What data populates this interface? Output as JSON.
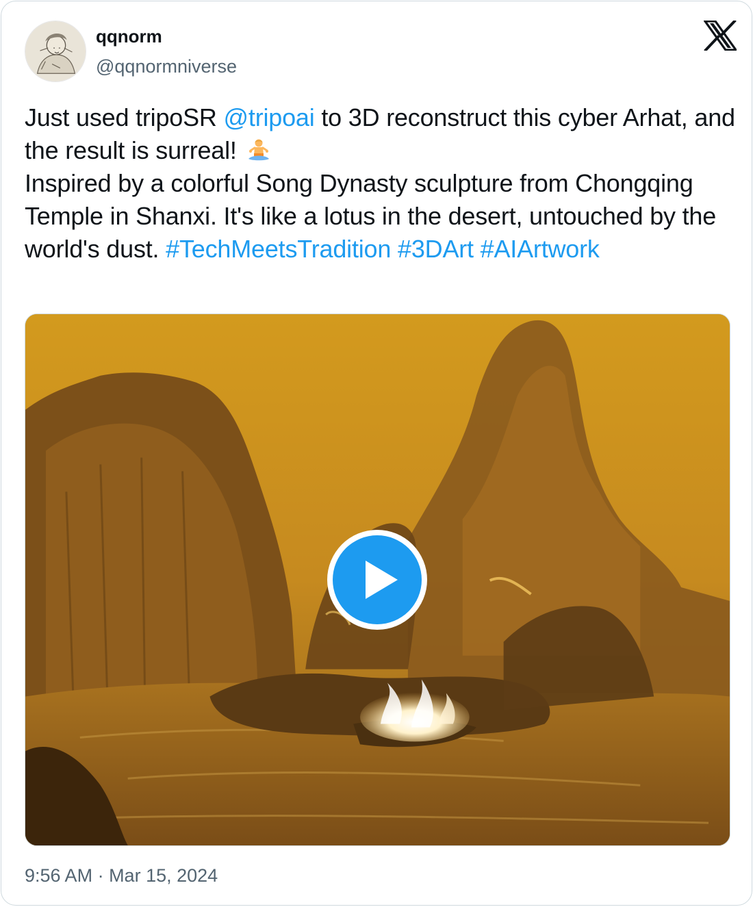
{
  "author": {
    "display_name": "qqnorm",
    "handle": "@qqnormniverse"
  },
  "tweet": {
    "text_1": "Just used tripoSR ",
    "mention": "@tripoai",
    "text_2": " to 3D reconstruct this cyber Arhat, and the result is surreal! ",
    "emoji": "person-in-lotus-position",
    "text_3": "Inspired by a colorful Song Dynasty sculpture from Chongqing Temple in Shanxi. It's like a lotus in the desert, untouched by the world's dust. ",
    "hashtag_1": "#TechMeetsTradition",
    "hashtag_2": "#3DArt",
    "hashtag_3": "#AIArtwork"
  },
  "media": {
    "type": "video",
    "play_icon": "play-icon"
  },
  "timestamp": {
    "time": "9:56 AM",
    "separator": " · ",
    "date": "Mar 15, 2024"
  },
  "icons": {
    "platform_logo": "x-logo-icon"
  },
  "colors": {
    "link": "#1d9bf0",
    "text": "#0f1419",
    "secondary": "#536471",
    "border": "#cfd9de"
  }
}
